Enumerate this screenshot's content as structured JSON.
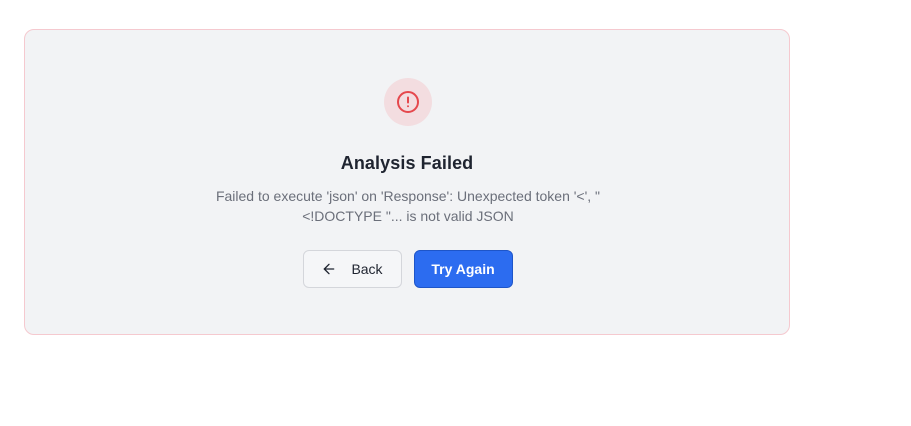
{
  "error": {
    "title": "Analysis Failed",
    "message_line1": "Failed to execute 'json' on 'Response': Unexpected token '<', \"",
    "message_line2": "<!DOCTYPE \"... is not valid JSON",
    "icon": "alert-circle-icon"
  },
  "actions": {
    "back_label": "Back",
    "back_icon": "arrow-left-icon",
    "retry_label": "Try Again"
  },
  "colors": {
    "card_background": "#f2f3f5",
    "card_border": "#f5c9cf",
    "error_icon": "#e5484d",
    "primary": "#2c6cf0"
  }
}
